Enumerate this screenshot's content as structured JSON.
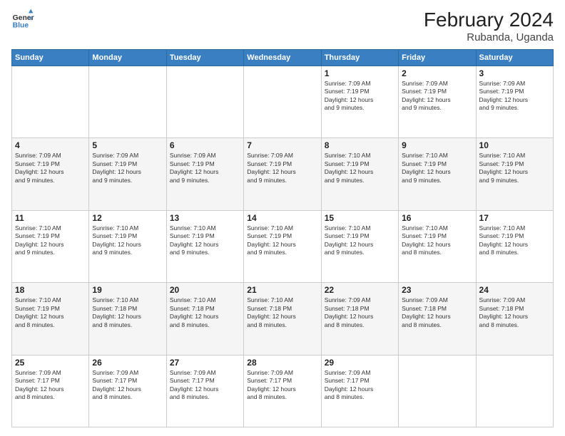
{
  "header": {
    "logo_line1": "General",
    "logo_line2": "Blue",
    "title": "February 2024",
    "subtitle": "Rubanda, Uganda"
  },
  "days_of_week": [
    "Sunday",
    "Monday",
    "Tuesday",
    "Wednesday",
    "Thursday",
    "Friday",
    "Saturday"
  ],
  "weeks": [
    [
      {
        "day": "",
        "info": ""
      },
      {
        "day": "",
        "info": ""
      },
      {
        "day": "",
        "info": ""
      },
      {
        "day": "",
        "info": ""
      },
      {
        "day": "1",
        "info": "Sunrise: 7:09 AM\nSunset: 7:19 PM\nDaylight: 12 hours\nand 9 minutes."
      },
      {
        "day": "2",
        "info": "Sunrise: 7:09 AM\nSunset: 7:19 PM\nDaylight: 12 hours\nand 9 minutes."
      },
      {
        "day": "3",
        "info": "Sunrise: 7:09 AM\nSunset: 7:19 PM\nDaylight: 12 hours\nand 9 minutes."
      }
    ],
    [
      {
        "day": "4",
        "info": "Sunrise: 7:09 AM\nSunset: 7:19 PM\nDaylight: 12 hours\nand 9 minutes."
      },
      {
        "day": "5",
        "info": "Sunrise: 7:09 AM\nSunset: 7:19 PM\nDaylight: 12 hours\nand 9 minutes."
      },
      {
        "day": "6",
        "info": "Sunrise: 7:09 AM\nSunset: 7:19 PM\nDaylight: 12 hours\nand 9 minutes."
      },
      {
        "day": "7",
        "info": "Sunrise: 7:09 AM\nSunset: 7:19 PM\nDaylight: 12 hours\nand 9 minutes."
      },
      {
        "day": "8",
        "info": "Sunrise: 7:10 AM\nSunset: 7:19 PM\nDaylight: 12 hours\nand 9 minutes."
      },
      {
        "day": "9",
        "info": "Sunrise: 7:10 AM\nSunset: 7:19 PM\nDaylight: 12 hours\nand 9 minutes."
      },
      {
        "day": "10",
        "info": "Sunrise: 7:10 AM\nSunset: 7:19 PM\nDaylight: 12 hours\nand 9 minutes."
      }
    ],
    [
      {
        "day": "11",
        "info": "Sunrise: 7:10 AM\nSunset: 7:19 PM\nDaylight: 12 hours\nand 9 minutes."
      },
      {
        "day": "12",
        "info": "Sunrise: 7:10 AM\nSunset: 7:19 PM\nDaylight: 12 hours\nand 9 minutes."
      },
      {
        "day": "13",
        "info": "Sunrise: 7:10 AM\nSunset: 7:19 PM\nDaylight: 12 hours\nand 9 minutes."
      },
      {
        "day": "14",
        "info": "Sunrise: 7:10 AM\nSunset: 7:19 PM\nDaylight: 12 hours\nand 9 minutes."
      },
      {
        "day": "15",
        "info": "Sunrise: 7:10 AM\nSunset: 7:19 PM\nDaylight: 12 hours\nand 9 minutes."
      },
      {
        "day": "16",
        "info": "Sunrise: 7:10 AM\nSunset: 7:19 PM\nDaylight: 12 hours\nand 8 minutes."
      },
      {
        "day": "17",
        "info": "Sunrise: 7:10 AM\nSunset: 7:19 PM\nDaylight: 12 hours\nand 8 minutes."
      }
    ],
    [
      {
        "day": "18",
        "info": "Sunrise: 7:10 AM\nSunset: 7:19 PM\nDaylight: 12 hours\nand 8 minutes."
      },
      {
        "day": "19",
        "info": "Sunrise: 7:10 AM\nSunset: 7:18 PM\nDaylight: 12 hours\nand 8 minutes."
      },
      {
        "day": "20",
        "info": "Sunrise: 7:10 AM\nSunset: 7:18 PM\nDaylight: 12 hours\nand 8 minutes."
      },
      {
        "day": "21",
        "info": "Sunrise: 7:10 AM\nSunset: 7:18 PM\nDaylight: 12 hours\nand 8 minutes."
      },
      {
        "day": "22",
        "info": "Sunrise: 7:09 AM\nSunset: 7:18 PM\nDaylight: 12 hours\nand 8 minutes."
      },
      {
        "day": "23",
        "info": "Sunrise: 7:09 AM\nSunset: 7:18 PM\nDaylight: 12 hours\nand 8 minutes."
      },
      {
        "day": "24",
        "info": "Sunrise: 7:09 AM\nSunset: 7:18 PM\nDaylight: 12 hours\nand 8 minutes."
      }
    ],
    [
      {
        "day": "25",
        "info": "Sunrise: 7:09 AM\nSunset: 7:17 PM\nDaylight: 12 hours\nand 8 minutes."
      },
      {
        "day": "26",
        "info": "Sunrise: 7:09 AM\nSunset: 7:17 PM\nDaylight: 12 hours\nand 8 minutes."
      },
      {
        "day": "27",
        "info": "Sunrise: 7:09 AM\nSunset: 7:17 PM\nDaylight: 12 hours\nand 8 minutes."
      },
      {
        "day": "28",
        "info": "Sunrise: 7:09 AM\nSunset: 7:17 PM\nDaylight: 12 hours\nand 8 minutes."
      },
      {
        "day": "29",
        "info": "Sunrise: 7:09 AM\nSunset: 7:17 PM\nDaylight: 12 hours\nand 8 minutes."
      },
      {
        "day": "",
        "info": ""
      },
      {
        "day": "",
        "info": ""
      }
    ]
  ]
}
